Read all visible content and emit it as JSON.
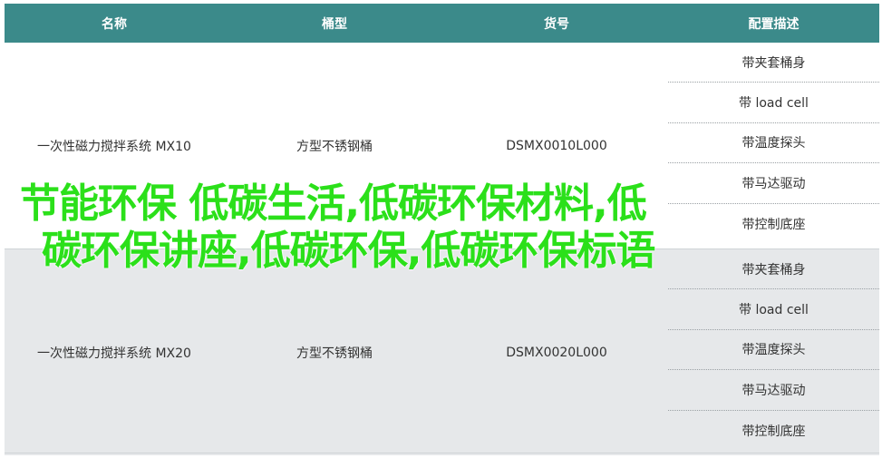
{
  "table": {
    "headers": [
      "名称",
      "桶型",
      "货号",
      "配置描述"
    ],
    "groups": [
      {
        "name": "一次性磁力搅拌系统 MX10",
        "tank": "方型不锈钢桶",
        "sku": "DSMX0010L000",
        "configs": [
          "带夹套桶身",
          "带 load cell",
          "带温度探头",
          "带马达驱动",
          "带控制底座"
        ]
      },
      {
        "name": "一次性磁力搅拌系统 MX20",
        "tank": "方型不锈钢桶",
        "sku": "DSMX0020L000",
        "configs": [
          "带夹套桶身",
          "带 load cell",
          "带温度探头",
          "带马达驱动",
          "带控制底座"
        ]
      }
    ]
  },
  "overlay": {
    "line1": "节能环保 低碳生活,低碳环保材料,低",
    "line2": "碳环保讲座,低碳环保,低碳环保标语"
  },
  "colors": {
    "header_bg": "#3b8a8a",
    "alt_row_bg": "#e6e8ea",
    "overlay_text": "#2be01a"
  }
}
